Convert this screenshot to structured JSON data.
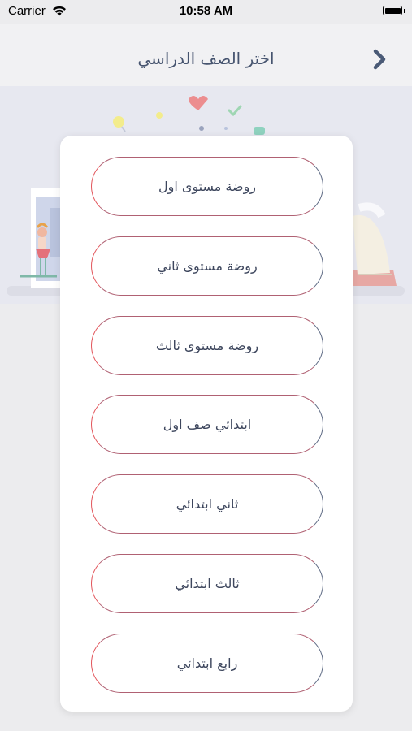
{
  "status_bar": {
    "carrier": "Carrier",
    "time": "10:58 AM"
  },
  "nav": {
    "title": "اختر الصف الدراسي",
    "back_icon": "chevron-right-icon"
  },
  "grades": [
    {
      "label": "روضة مستوى اول"
    },
    {
      "label": "روضة مستوى ثاني"
    },
    {
      "label": "روضة مستوى ثالث"
    },
    {
      "label": "ابتدائي صف اول"
    },
    {
      "label": "ثاني ابتدائي"
    },
    {
      "label": "ثالث ابتدائي"
    },
    {
      "label": "رابع ابتدائي"
    }
  ],
  "colors": {
    "background": "#ececee",
    "title": "#46546f",
    "button_border_left": "#e2555b",
    "button_border_right": "#5e6a84",
    "back_arrow": "#4a5a76"
  }
}
